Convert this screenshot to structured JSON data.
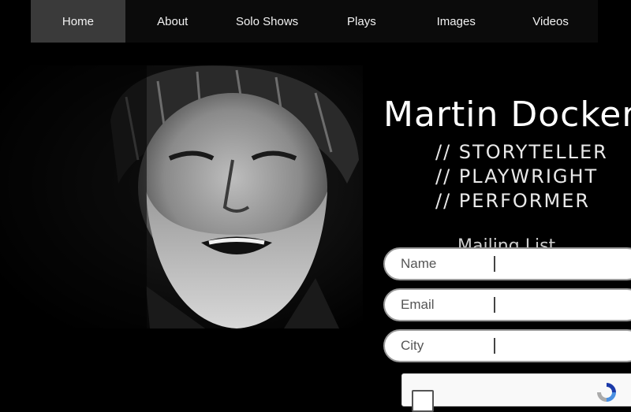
{
  "nav": {
    "items": [
      {
        "label": "Home",
        "active": true
      },
      {
        "label": "About",
        "active": false
      },
      {
        "label": "Solo Shows",
        "active": false
      },
      {
        "label": "Plays",
        "active": false
      },
      {
        "label": "Images",
        "active": false
      },
      {
        "label": "Videos",
        "active": false
      }
    ]
  },
  "hero": {
    "name": "Martin Dockery",
    "roles": [
      "// STORYTELLER",
      "// PLAYWRIGHT",
      "// PERFORMER"
    ],
    "mailing_heading": "Mailing List"
  },
  "form": {
    "name_placeholder": "Name",
    "email_placeholder": "Email",
    "city_placeholder": "City"
  },
  "colors": {
    "background": "#000000",
    "nav_bg": "#0b0b0b",
    "nav_active": "#3a3a3a",
    "field_border": "#9a9a9a"
  }
}
